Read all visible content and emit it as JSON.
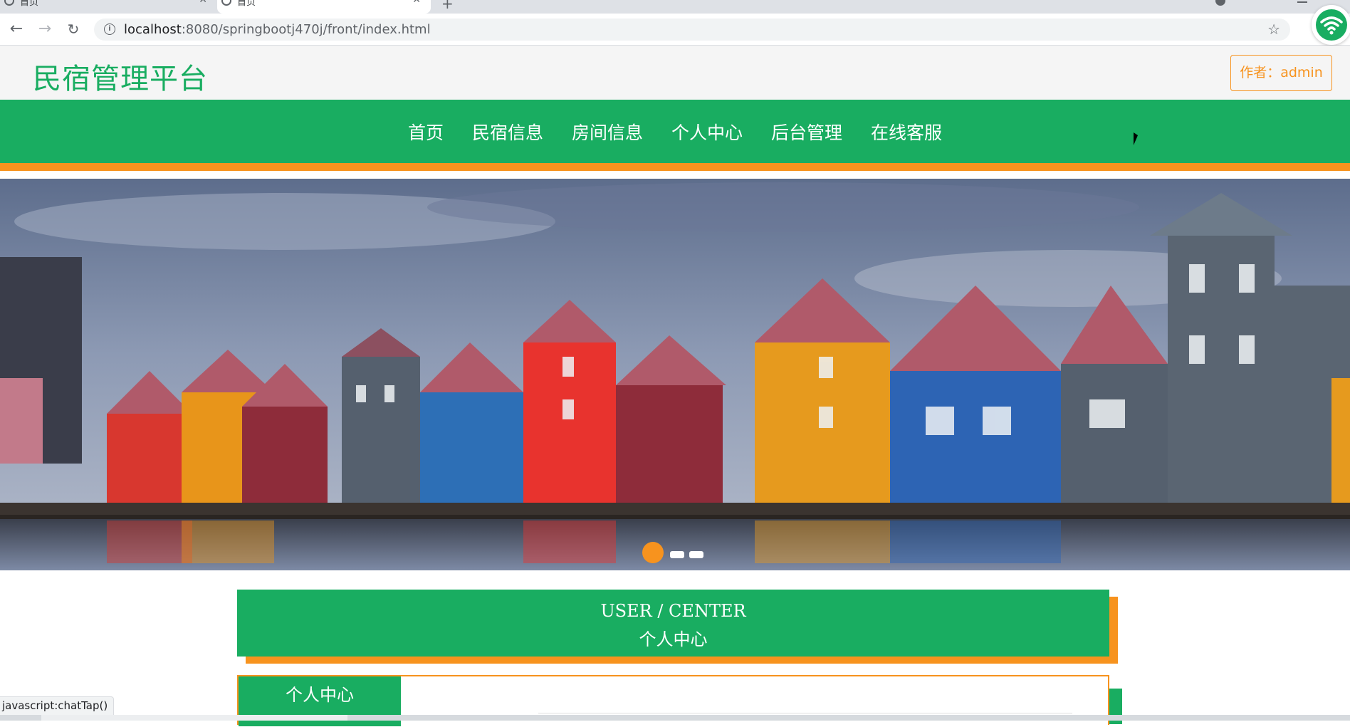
{
  "browser": {
    "tabs": [
      {
        "label": "首页"
      },
      {
        "label": "首页"
      }
    ],
    "new_tab_label": "+",
    "url_host": "localhost",
    "url_rest": ":8080/springbootj470j/front/index.html",
    "status_text": "javascript:chatTap()"
  },
  "header": {
    "logo": "民宿管理平台",
    "author": "作者：admin"
  },
  "nav": {
    "items": [
      {
        "label": "首页"
      },
      {
        "label": "民宿信息"
      },
      {
        "label": "房间信息"
      },
      {
        "label": "个人中心"
      },
      {
        "label": "后台管理"
      },
      {
        "label": "在线客服"
      }
    ]
  },
  "carousel": {
    "slide_count": 3,
    "active_index": 0
  },
  "section": {
    "title_en": "USER / CENTER",
    "title_cn": "个人中心",
    "side_tab": "个人中心"
  },
  "colors": {
    "primary": "#19ad61",
    "accent": "#f7931e"
  },
  "icons": {
    "back": "arrow-left-icon",
    "forward": "arrow-right-icon",
    "reload": "reload-icon",
    "info": "info-icon",
    "bookmark": "star-icon",
    "extension": "wifi-icon"
  }
}
